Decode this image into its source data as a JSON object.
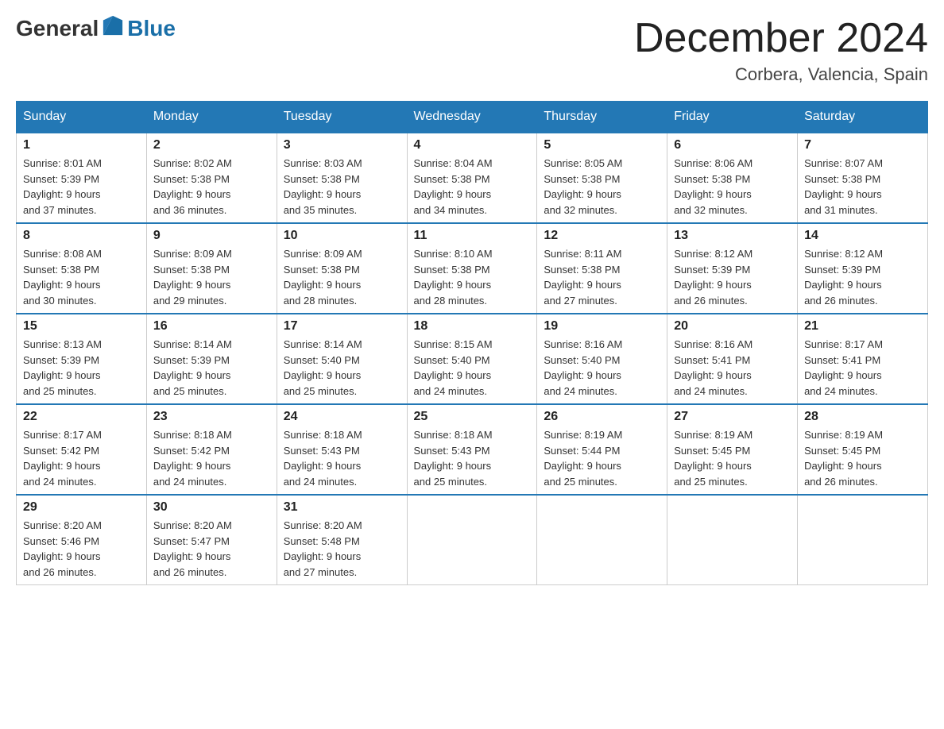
{
  "logo": {
    "text_general": "General",
    "text_blue": "Blue"
  },
  "title": "December 2024",
  "location": "Corbera, Valencia, Spain",
  "days_of_week": [
    "Sunday",
    "Monday",
    "Tuesday",
    "Wednesday",
    "Thursday",
    "Friday",
    "Saturday"
  ],
  "weeks": [
    [
      {
        "day": "1",
        "sunrise": "8:01 AM",
        "sunset": "5:39 PM",
        "daylight": "9 hours and 37 minutes."
      },
      {
        "day": "2",
        "sunrise": "8:02 AM",
        "sunset": "5:38 PM",
        "daylight": "9 hours and 36 minutes."
      },
      {
        "day": "3",
        "sunrise": "8:03 AM",
        "sunset": "5:38 PM",
        "daylight": "9 hours and 35 minutes."
      },
      {
        "day": "4",
        "sunrise": "8:04 AM",
        "sunset": "5:38 PM",
        "daylight": "9 hours and 34 minutes."
      },
      {
        "day": "5",
        "sunrise": "8:05 AM",
        "sunset": "5:38 PM",
        "daylight": "9 hours and 32 minutes."
      },
      {
        "day": "6",
        "sunrise": "8:06 AM",
        "sunset": "5:38 PM",
        "daylight": "9 hours and 32 minutes."
      },
      {
        "day": "7",
        "sunrise": "8:07 AM",
        "sunset": "5:38 PM",
        "daylight": "9 hours and 31 minutes."
      }
    ],
    [
      {
        "day": "8",
        "sunrise": "8:08 AM",
        "sunset": "5:38 PM",
        "daylight": "9 hours and 30 minutes."
      },
      {
        "day": "9",
        "sunrise": "8:09 AM",
        "sunset": "5:38 PM",
        "daylight": "9 hours and 29 minutes."
      },
      {
        "day": "10",
        "sunrise": "8:09 AM",
        "sunset": "5:38 PM",
        "daylight": "9 hours and 28 minutes."
      },
      {
        "day": "11",
        "sunrise": "8:10 AM",
        "sunset": "5:38 PM",
        "daylight": "9 hours and 28 minutes."
      },
      {
        "day": "12",
        "sunrise": "8:11 AM",
        "sunset": "5:38 PM",
        "daylight": "9 hours and 27 minutes."
      },
      {
        "day": "13",
        "sunrise": "8:12 AM",
        "sunset": "5:39 PM",
        "daylight": "9 hours and 26 minutes."
      },
      {
        "day": "14",
        "sunrise": "8:12 AM",
        "sunset": "5:39 PM",
        "daylight": "9 hours and 26 minutes."
      }
    ],
    [
      {
        "day": "15",
        "sunrise": "8:13 AM",
        "sunset": "5:39 PM",
        "daylight": "9 hours and 25 minutes."
      },
      {
        "day": "16",
        "sunrise": "8:14 AM",
        "sunset": "5:39 PM",
        "daylight": "9 hours and 25 minutes."
      },
      {
        "day": "17",
        "sunrise": "8:14 AM",
        "sunset": "5:40 PM",
        "daylight": "9 hours and 25 minutes."
      },
      {
        "day": "18",
        "sunrise": "8:15 AM",
        "sunset": "5:40 PM",
        "daylight": "9 hours and 24 minutes."
      },
      {
        "day": "19",
        "sunrise": "8:16 AM",
        "sunset": "5:40 PM",
        "daylight": "9 hours and 24 minutes."
      },
      {
        "day": "20",
        "sunrise": "8:16 AM",
        "sunset": "5:41 PM",
        "daylight": "9 hours and 24 minutes."
      },
      {
        "day": "21",
        "sunrise": "8:17 AM",
        "sunset": "5:41 PM",
        "daylight": "9 hours and 24 minutes."
      }
    ],
    [
      {
        "day": "22",
        "sunrise": "8:17 AM",
        "sunset": "5:42 PM",
        "daylight": "9 hours and 24 minutes."
      },
      {
        "day": "23",
        "sunrise": "8:18 AM",
        "sunset": "5:42 PM",
        "daylight": "9 hours and 24 minutes."
      },
      {
        "day": "24",
        "sunrise": "8:18 AM",
        "sunset": "5:43 PM",
        "daylight": "9 hours and 24 minutes."
      },
      {
        "day": "25",
        "sunrise": "8:18 AM",
        "sunset": "5:43 PM",
        "daylight": "9 hours and 25 minutes."
      },
      {
        "day": "26",
        "sunrise": "8:19 AM",
        "sunset": "5:44 PM",
        "daylight": "9 hours and 25 minutes."
      },
      {
        "day": "27",
        "sunrise": "8:19 AM",
        "sunset": "5:45 PM",
        "daylight": "9 hours and 25 minutes."
      },
      {
        "day": "28",
        "sunrise": "8:19 AM",
        "sunset": "5:45 PM",
        "daylight": "9 hours and 26 minutes."
      }
    ],
    [
      {
        "day": "29",
        "sunrise": "8:20 AM",
        "sunset": "5:46 PM",
        "daylight": "9 hours and 26 minutes."
      },
      {
        "day": "30",
        "sunrise": "8:20 AM",
        "sunset": "5:47 PM",
        "daylight": "9 hours and 26 minutes."
      },
      {
        "day": "31",
        "sunrise": "8:20 AM",
        "sunset": "5:48 PM",
        "daylight": "9 hours and 27 minutes."
      },
      null,
      null,
      null,
      null
    ]
  ],
  "labels": {
    "sunrise": "Sunrise:",
    "sunset": "Sunset:",
    "daylight": "Daylight:"
  }
}
